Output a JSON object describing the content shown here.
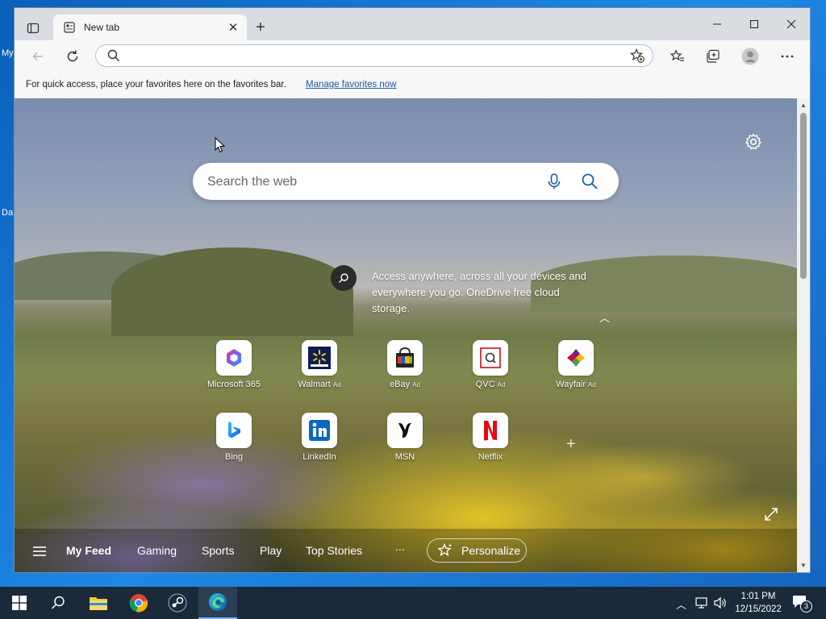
{
  "desktop": {
    "fragment1": "My",
    "fragment2": "Da"
  },
  "browser": {
    "tab": {
      "title": "New tab"
    },
    "address": {
      "placeholder": "",
      "value": ""
    },
    "favorites_bar": {
      "message": "For quick access, place your favorites here on the favorites bar.",
      "link": "Manage favorites now"
    }
  },
  "page": {
    "search": {
      "placeholder": "Search the web"
    },
    "promo": {
      "text": "Access anywhere, across all your devices and everywhere you go. OneDrive free cloud storage."
    },
    "tiles": [
      {
        "name": "Microsoft 365",
        "ad": "",
        "icon": "m365-icon"
      },
      {
        "name": "Walmart",
        "ad": "Ad",
        "icon": "walmart-icon"
      },
      {
        "name": "eBay",
        "ad": "Ad",
        "icon": "ebay-icon"
      },
      {
        "name": "QVC",
        "ad": "Ad",
        "icon": "qvc-icon"
      },
      {
        "name": "Wayfair",
        "ad": "Ad",
        "icon": "wayfair-icon"
      },
      {
        "name": "Bing",
        "ad": "",
        "icon": "bing-icon"
      },
      {
        "name": "LinkedIn",
        "ad": "",
        "icon": "linkedin-icon"
      },
      {
        "name": "MSN",
        "ad": "",
        "icon": "msn-icon"
      },
      {
        "name": "Netflix",
        "ad": "",
        "icon": "netflix-icon"
      }
    ],
    "feed": {
      "items": [
        "My Feed",
        "Gaming",
        "Sports",
        "Play",
        "Top Stories",
        "..."
      ],
      "personalize": "Personalize"
    }
  },
  "taskbar": {
    "time": "1:01 PM",
    "date": "12/15/2022",
    "notifications": "3"
  },
  "colors": {
    "accent": "#0078d4",
    "link": "#1a5aa6",
    "taskbar": "#1a2a3a",
    "desktop": "#1565c0"
  }
}
